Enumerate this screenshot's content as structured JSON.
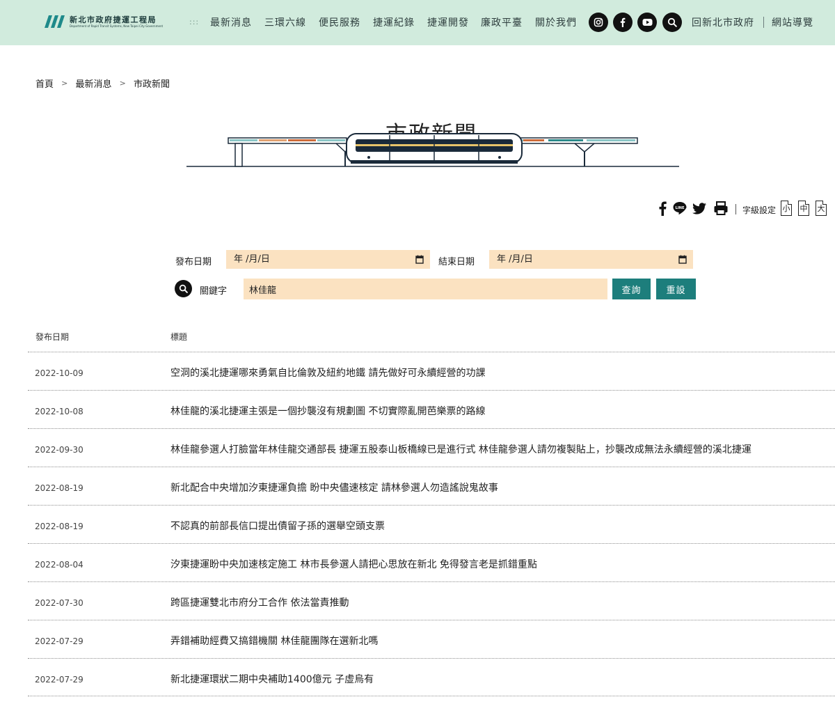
{
  "header": {
    "logo_text_cn": "新北市政府捷運工程局",
    "logo_text_en": "Department of Rapid Transit Systems, New Taipei City Government",
    "nav_dots": ":::",
    "nav": [
      "最新消息",
      "三環六線",
      "便民服務",
      "捷運紀錄",
      "捷運開發",
      "廉政平臺",
      "關於我們"
    ],
    "social_icons": [
      "instagram-icon",
      "facebook-icon",
      "youtube-icon",
      "search-icon"
    ],
    "links": [
      "回新北市政府",
      "網站導覽"
    ],
    "bg_color": "#d1ebdd"
  },
  "breadcrumb": [
    "首頁",
    "最新消息",
    "市政新聞"
  ],
  "breadcrumb_sep": ">",
  "page_title": "市政新聞",
  "tools": {
    "share_icons": [
      "facebook-icon",
      "line-icon",
      "twitter-icon",
      "print-icon"
    ],
    "font_label": "字級設定",
    "font_sizes": [
      "小",
      "中",
      "大"
    ]
  },
  "search": {
    "start_label": "發布日期",
    "start_value": "年 /月/日",
    "end_label": "結束日期",
    "end_value": "年 /月/日",
    "keyword_label": "關鍵字",
    "keyword_value": "林佳龍",
    "submit_label": "查詢",
    "reset_label": "重設",
    "field_color": "#fbe2c1",
    "button_color": "#1d7e7c"
  },
  "table": {
    "headers": [
      "發布日期",
      "標題"
    ],
    "rows": [
      {
        "date": "2022-10-09",
        "title": "空洞的溪北捷運哪來勇氣自比倫敦及紐約地鐵 請先做好可永續經營的功課"
      },
      {
        "date": "2022-10-08",
        "title": "林佳龍的溪北捷運主張是一個抄襲沒有規劃圖 不切實際亂開芭樂票的路線"
      },
      {
        "date": "2022-09-30",
        "title": "林佳龍參選人打臉當年林佳龍交通部長 捷運五股泰山板橋線已是進行式 林佳龍參選人請勿複製貼上，抄襲改成無法永續經營的溪北捷運"
      },
      {
        "date": "2022-08-19",
        "title": "新北配合中央增加汐東捷運負擔 盼中央儘速核定 請林參選人勿造謠說鬼故事"
      },
      {
        "date": "2022-08-19",
        "title": "不認真的前部長信口提出債留子孫的選舉空頭支票"
      },
      {
        "date": "2022-08-04",
        "title": "汐東捷運盼中央加速核定施工 林市長參選人請把心思放在新北 免得發言老是抓錯重點"
      },
      {
        "date": "2022-07-30",
        "title": "跨區捷運雙北市府分工合作 依法當責推動"
      },
      {
        "date": "2022-07-29",
        "title": "弄錯補助經費又搞錯機關 林佳龍團隊在選新北嗎"
      },
      {
        "date": "2022-07-29",
        "title": "新北捷運環狀二期中央補助1400億元 子虛烏有"
      }
    ]
  }
}
